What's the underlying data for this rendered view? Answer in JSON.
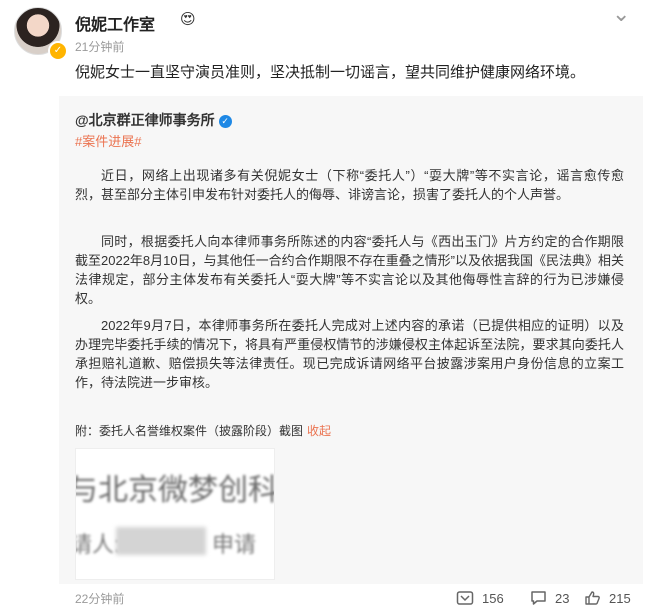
{
  "post": {
    "user_name": "倪妮工作室",
    "time": "21分钟前",
    "text": "倪妮女士一直坚守演员准则，坚决抵制一切谣言，望共同维护健康网络环境。"
  },
  "repost": {
    "source": "@北京群正律师事务所",
    "tag": "#案件进展#",
    "paragraphs": [
      "近日，网络上出现诸多有关倪妮女士（下称“委托人”）“耍大牌”等不实言论，谣言愈传愈烈，甚至部分主体引申发布针对委托人的侮辱、诽谤言论，损害了委托人的个人声誉。",
      "同时，根据委托人向本律师事务所陈述的内容“委托人与《西出玉门》片方约定的合作期限截至2022年8月10日，与其他任一合约合作期限不存在重叠之情形”以及依据我国《民法典》相关法律规定，部分主体发布有关委托人“耍大牌”等不实言论以及其他侮辱性言辞的行为已涉嫌侵权。",
      "2022年9月7日，本律师事务所在委托人完成对上述内容的承诺（已提供相应的证明）以及办理完毕委托手续的情况下，将具有严重侵权情节的涉嫌侵权主体起诉至法院，要求其向委托人承担赔礼道歉、赔偿损失等法律责任。现已完成诉请网络平台披露涉案用户身份信息的立案工作，待法院进一步审核。"
    ],
    "attachment_label": "附：委托人名誉维权案件（披露阶段）截图",
    "collapse": "收起",
    "image_text_line1": "与北京微梦创科",
    "image_text_line2a": "请人:",
    "image_text_line2b": "申请"
  },
  "footer": {
    "time": "22分钟前",
    "reposts": "156",
    "comments": "23",
    "likes": "215"
  },
  "colors": {
    "accent": "#eb7350",
    "verified_blue": "#1e88e5",
    "verified_gold": "#ffb400"
  },
  "icons": [
    "verified-badge-icon",
    "more-icon",
    "repost-icon",
    "comment-icon",
    "like-icon"
  ]
}
